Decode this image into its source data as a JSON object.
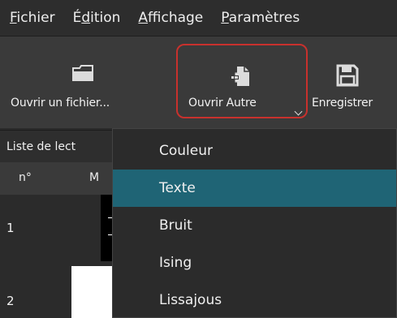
{
  "menubar": {
    "items": [
      {
        "pre": "",
        "ul": "F",
        "post": "ichier"
      },
      {
        "pre": "É",
        "ul": "d",
        "post": "ition"
      },
      {
        "pre": "",
        "ul": "A",
        "post": "ffichage"
      },
      {
        "pre": "",
        "ul": "P",
        "post": "aramètres"
      }
    ]
  },
  "toolbar": {
    "open_label": "Ouvrir un fichier...",
    "other_label": "Ouvrir Autre",
    "save_label": "Enregistrer",
    "icons": [
      "folder-icon",
      "new-file-icon",
      "save-icon"
    ],
    "highlight_color": "#c8312d"
  },
  "playlist": {
    "title": "Liste de lect",
    "columns": [
      "n°",
      "M"
    ],
    "rows": [
      {
        "num": "1"
      },
      {
        "num": "2"
      }
    ]
  },
  "dropdown": {
    "items": [
      "Couleur",
      "Texte",
      "Bruit",
      "Ising",
      "Lissajous"
    ],
    "selected_index": 1,
    "selected_color": "#1f6475"
  }
}
